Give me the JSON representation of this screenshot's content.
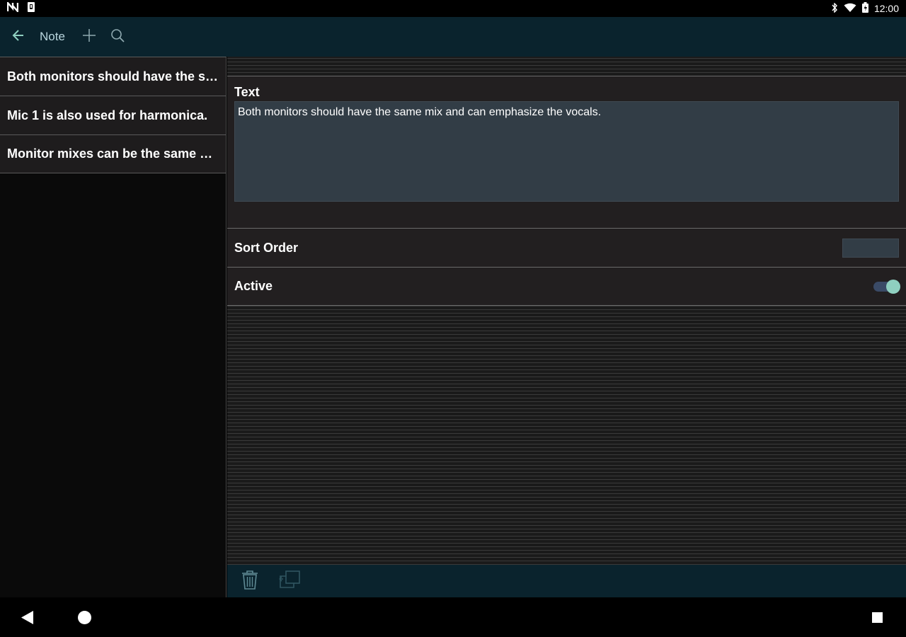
{
  "status_bar": {
    "time": "12:00",
    "left_icons": [
      "n-notification-icon",
      "sim-icon"
    ],
    "right_icons": [
      "bluetooth-icon",
      "wifi-icon",
      "battery-icon"
    ]
  },
  "app_bar": {
    "title": "Note",
    "back_icon": "arrow-left-icon",
    "add_icon": "plus-icon",
    "search_icon": "search-icon"
  },
  "notes_list": {
    "items": [
      {
        "label": "Both monitors should have the same mix and can emphasize the vocals."
      },
      {
        "label": "Mic 1 is also used for harmonica. "
      },
      {
        "label": "Monitor mixes can be the same and..."
      }
    ]
  },
  "detail": {
    "text_label": "Text",
    "text_value": "Both monitors should have the same mix and can emphasize the vocals.",
    "sort_order_label": "Sort Order",
    "sort_order_value": "",
    "active_label": "Active",
    "active_value": true
  },
  "toolbar": {
    "delete_icon": "trash-icon",
    "copy_icon": "copy-icon"
  },
  "nav_bar": {
    "back_icon": "nav-back-icon",
    "home_icon": "nav-home-icon",
    "recents_icon": "nav-recents-icon"
  },
  "colors": {
    "app_bar_bg": "#0a232d",
    "accent": "#8fd0c0",
    "field_bg": "#323d46",
    "row_bg": "#221f20"
  }
}
